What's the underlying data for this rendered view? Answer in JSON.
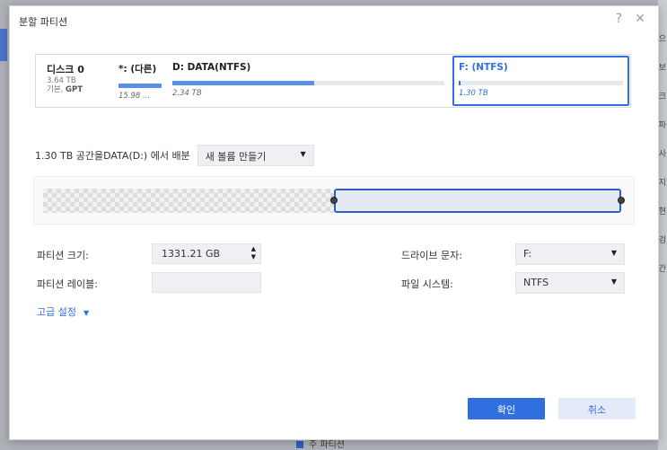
{
  "background": {
    "right_fragments": [
      "으",
      "보",
      "크",
      "파",
      "사",
      "지",
      "현",
      "검",
      "간"
    ],
    "bottom_text": "주 파티션"
  },
  "dialog": {
    "title": "분할 파티션",
    "help_glyph": "?",
    "close_glyph": "✕"
  },
  "disk": {
    "name": "디스크 0",
    "size": "3.64 TB",
    "type_prefix": "기본, ",
    "type_bold": "GPT",
    "partitions": [
      {
        "name": "*: (다른)",
        "size": "15.98 ...",
        "fill": 1.0
      },
      {
        "name": "D: DATA(NTFS)",
        "size": "2.34 TB",
        "fill": 0.52
      },
      {
        "name": "F: (NTFS)",
        "size": "1.30 TB",
        "fill": 0.01,
        "selected": true
      }
    ]
  },
  "allocate": {
    "label": "1.30 TB 공간을DATA(D:) 에서 배분",
    "selected": "새 볼륨 만들기"
  },
  "form": {
    "size_label": "파티션 크기:",
    "size_value": "1331.21 GB",
    "volume_label": "파티션 레이블:",
    "volume_value": "",
    "drive_letter_label": "드라이브 문자:",
    "drive_letter_value": "F:",
    "fs_label": "파일 시스템:",
    "fs_value": "NTFS"
  },
  "advanced": {
    "label": "고급 설정"
  },
  "buttons": {
    "ok": "확인",
    "cancel": "취소"
  },
  "colors": {
    "accent": "#2f6fe0",
    "bar": "#5b8fe4"
  }
}
